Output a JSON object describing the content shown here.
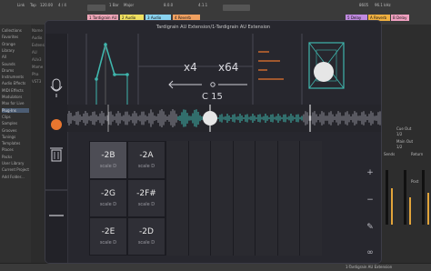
{
  "host": {
    "top_labels": [
      "Link",
      "Tap",
      "120.00",
      "4 / 4",
      "1 Bar",
      "Major",
      "8.0.0",
      "4.1.1",
      "8605",
      "96.1 kHz"
    ],
    "track_headers": [
      {
        "label": "1 Tardigrain AU E",
        "color": "#f0a6b8"
      },
      {
        "label": "2 Audio",
        "color": "#f0e060"
      },
      {
        "label": "3 Audio",
        "color": "#8ad4f0"
      },
      {
        "label": "4 Reverb",
        "color": "#f0a060"
      },
      {
        "label": "5 Delay",
        "color": "#c08ae0"
      },
      {
        "label": "A Reverb",
        "color": "#f0b040"
      },
      {
        "label": "B Delay",
        "color": "#f0a0c0"
      }
    ],
    "sidebar_items": [
      "Collections",
      "Favorites",
      "Orange",
      "Library",
      "All",
      "Sounds",
      "Drums",
      "Instruments",
      "Audio Effects",
      "MIDI Effects",
      "Modulators",
      "Max for Live",
      "Plug-Ins",
      "Clips",
      "Samples",
      "Grooves",
      "Tunings",
      "Templates",
      "Places",
      "Packs",
      "User Library",
      "Current Project",
      "Add Folder..."
    ],
    "sidebar_selected": "Plug-Ins",
    "browser_items": [
      "Name",
      "Audio",
      "Extension",
      "AU",
      "AUv3",
      "Mame",
      "Pha",
      "VST3"
    ],
    "mixer_labels": [
      "Cue Out",
      "1/2",
      "Main Out",
      "1/2",
      "Sends",
      "Return",
      "Post"
    ],
    "bottom_label": "1-Tardigrain AU Extension"
  },
  "plugin": {
    "title": "Tardigrain AU Extension/1-Tardigrain AU Extension",
    "multiplier_a": "x4",
    "multiplier_b": "x64",
    "note_value": "C 15",
    "pads": [
      {
        "name": "-2B",
        "scale": "scale D",
        "selected": true
      },
      {
        "name": "-2A",
        "scale": "scale D",
        "selected": false
      },
      {
        "name": "-2G",
        "scale": "scale D",
        "selected": false
      },
      {
        "name": "-2F#",
        "scale": "scale D",
        "selected": false
      },
      {
        "name": "-2E",
        "scale": "scale D",
        "selected": false
      },
      {
        "name": "-2D",
        "scale": "scale D",
        "selected": false
      }
    ],
    "tools": [
      "+",
      "−",
      "✎",
      "∞"
    ],
    "icons": [
      "microphone-icon",
      "record-icon",
      "trash-icon",
      "plus-icon",
      "minus-icon",
      "pencil-icon",
      "loop-icon"
    ],
    "accent": "#e9762f",
    "teal": "#3fb6ad"
  }
}
